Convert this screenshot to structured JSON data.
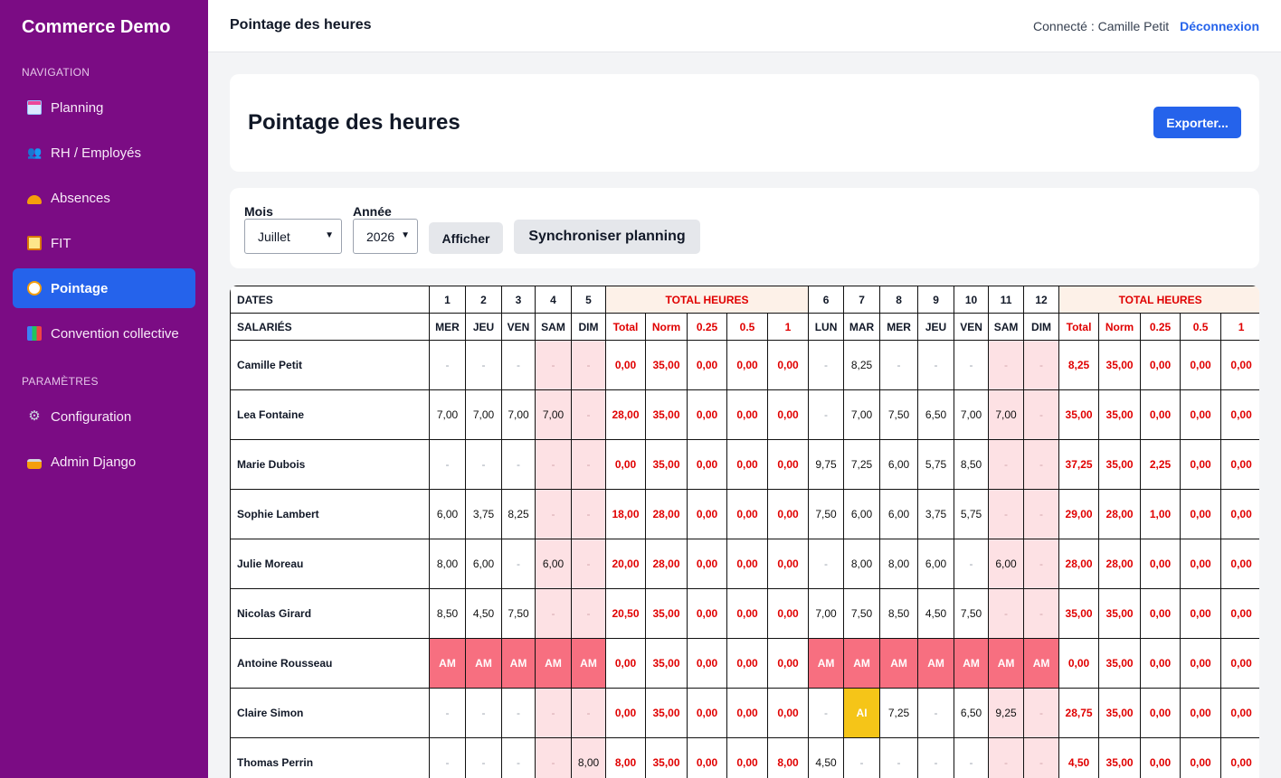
{
  "app": {
    "brand": "Commerce Demo"
  },
  "sidebar": {
    "nav_label": "NAVIGATION",
    "items": [
      {
        "label": "Planning",
        "icon": "calendar-icon"
      },
      {
        "label": "RH / Employés",
        "icon": "people-icon"
      },
      {
        "label": "Absences",
        "icon": "absence-icon"
      },
      {
        "label": "FIT",
        "icon": "clipboard-icon"
      },
      {
        "label": "Pointage",
        "icon": "clock-icon",
        "active": true
      },
      {
        "label": "Convention collective",
        "icon": "chart-icon"
      }
    ],
    "settings_label": "PARAMÈTRES",
    "settings_items": [
      {
        "label": "Configuration",
        "icon": "gear-icon"
      },
      {
        "label": "Admin Django",
        "icon": "lock-icon"
      }
    ]
  },
  "topbar": {
    "title": "Pointage des heures",
    "user": "Connecté : Camille Petit",
    "logout": "Déconnexion"
  },
  "header": {
    "title": "Pointage des heures",
    "export": "Exporter..."
  },
  "filters": {
    "month_label": "Mois",
    "month_value": "Juillet",
    "year_label": "Année",
    "year_value": "2026",
    "show_btn": "Afficher",
    "sync_btn": "Synchroniser planning"
  },
  "table": {
    "dates_label": "DATES",
    "employees_label": "SALARIÉS",
    "total_label": "TOTAL HEURES",
    "total_cols": [
      "Total",
      "Norm",
      "0.25",
      "0.5",
      "1"
    ],
    "week1": {
      "days": [
        "1",
        "2",
        "3",
        "4",
        "5"
      ],
      "dow": [
        "MER",
        "JEU",
        "VEN",
        "SAM",
        "DIM"
      ],
      "weekend": [
        false,
        false,
        false,
        true,
        true
      ]
    },
    "week2": {
      "days": [
        "6",
        "7",
        "8",
        "9",
        "10",
        "11",
        "12"
      ],
      "dow": [
        "LUN",
        "MAR",
        "MER",
        "JEU",
        "VEN",
        "SAM",
        "DIM"
      ],
      "weekend": [
        false,
        false,
        false,
        false,
        false,
        true,
        true
      ]
    },
    "rows": [
      {
        "name": "Camille Petit",
        "w1": [
          "-",
          "-",
          "-",
          "-",
          "-"
        ],
        "t1": [
          "0,00",
          "35,00",
          "0,00",
          "0,00",
          "0,00"
        ],
        "w2": [
          "-",
          "8,25",
          "-",
          "-",
          "-",
          "-",
          "-"
        ],
        "t2": [
          "8,25",
          "35,00",
          "0,00",
          "0,00",
          "0,00"
        ]
      },
      {
        "name": "Lea Fontaine",
        "w1": [
          "7,00",
          "7,00",
          "7,00",
          "7,00",
          "-"
        ],
        "t1": [
          "28,00",
          "35,00",
          "0,00",
          "0,00",
          "0,00"
        ],
        "w2": [
          "-",
          "7,00",
          "7,50",
          "6,50",
          "7,00",
          "7,00",
          "-"
        ],
        "t2": [
          "35,00",
          "35,00",
          "0,00",
          "0,00",
          "0,00"
        ]
      },
      {
        "name": "Marie Dubois",
        "w1": [
          "-",
          "-",
          "-",
          "-",
          "-"
        ],
        "t1": [
          "0,00",
          "35,00",
          "0,00",
          "0,00",
          "0,00"
        ],
        "w2": [
          "9,75",
          "7,25",
          "6,00",
          "5,75",
          "8,50",
          "-",
          "-"
        ],
        "t2": [
          "37,25",
          "35,00",
          "2,25",
          "0,00",
          "0,00"
        ]
      },
      {
        "name": "Sophie Lambert",
        "w1": [
          "6,00",
          "3,75",
          "8,25",
          "-",
          "-"
        ],
        "t1": [
          "18,00",
          "28,00",
          "0,00",
          "0,00",
          "0,00"
        ],
        "w2": [
          "7,50",
          "6,00",
          "6,00",
          "3,75",
          "5,75",
          "-",
          "-"
        ],
        "t2": [
          "29,00",
          "28,00",
          "1,00",
          "0,00",
          "0,00"
        ]
      },
      {
        "name": "Julie Moreau",
        "w1": [
          "8,00",
          "6,00",
          "-",
          "6,00",
          "-"
        ],
        "t1": [
          "20,00",
          "28,00",
          "0,00",
          "0,00",
          "0,00"
        ],
        "w2": [
          "-",
          "8,00",
          "8,00",
          "6,00",
          "-",
          "6,00",
          "-"
        ],
        "t2": [
          "28,00",
          "28,00",
          "0,00",
          "0,00",
          "0,00"
        ]
      },
      {
        "name": "Nicolas Girard",
        "w1": [
          "8,50",
          "4,50",
          "7,50",
          "-",
          "-"
        ],
        "t1": [
          "20,50",
          "35,00",
          "0,00",
          "0,00",
          "0,00"
        ],
        "w2": [
          "7,00",
          "7,50",
          "8,50",
          "4,50",
          "7,50",
          "-",
          "-"
        ],
        "t2": [
          "35,00",
          "35,00",
          "0,00",
          "0,00",
          "0,00"
        ]
      },
      {
        "name": "Antoine Rousseau",
        "w1": [
          "AM",
          "AM",
          "AM",
          "AM",
          "AM"
        ],
        "t1": [
          "0,00",
          "35,00",
          "0,00",
          "0,00",
          "0,00"
        ],
        "w2": [
          "AM",
          "AM",
          "AM",
          "AM",
          "AM",
          "AM",
          "AM"
        ],
        "t2": [
          "0,00",
          "35,00",
          "0,00",
          "0,00",
          "0,00"
        ]
      },
      {
        "name": "Claire Simon",
        "w1": [
          "-",
          "-",
          "-",
          "-",
          "-"
        ],
        "t1": [
          "0,00",
          "35,00",
          "0,00",
          "0,00",
          "0,00"
        ],
        "w2": [
          "-",
          "AI",
          "7,25",
          "-",
          "6,50",
          "9,25",
          "-"
        ],
        "t2": [
          "28,75",
          "35,00",
          "0,00",
          "0,00",
          "0,00"
        ]
      },
      {
        "name": "Thomas Perrin",
        "w1": [
          "-",
          "-",
          "-",
          "-",
          "8,00"
        ],
        "t1": [
          "8,00",
          "35,00",
          "0,00",
          "0,00",
          "8,00"
        ],
        "w2": [
          "4,50",
          "-",
          "-",
          "-",
          "-",
          "-",
          "-"
        ],
        "t2": [
          "4,50",
          "35,00",
          "0,00",
          "0,00",
          "0,00"
        ]
      }
    ]
  }
}
